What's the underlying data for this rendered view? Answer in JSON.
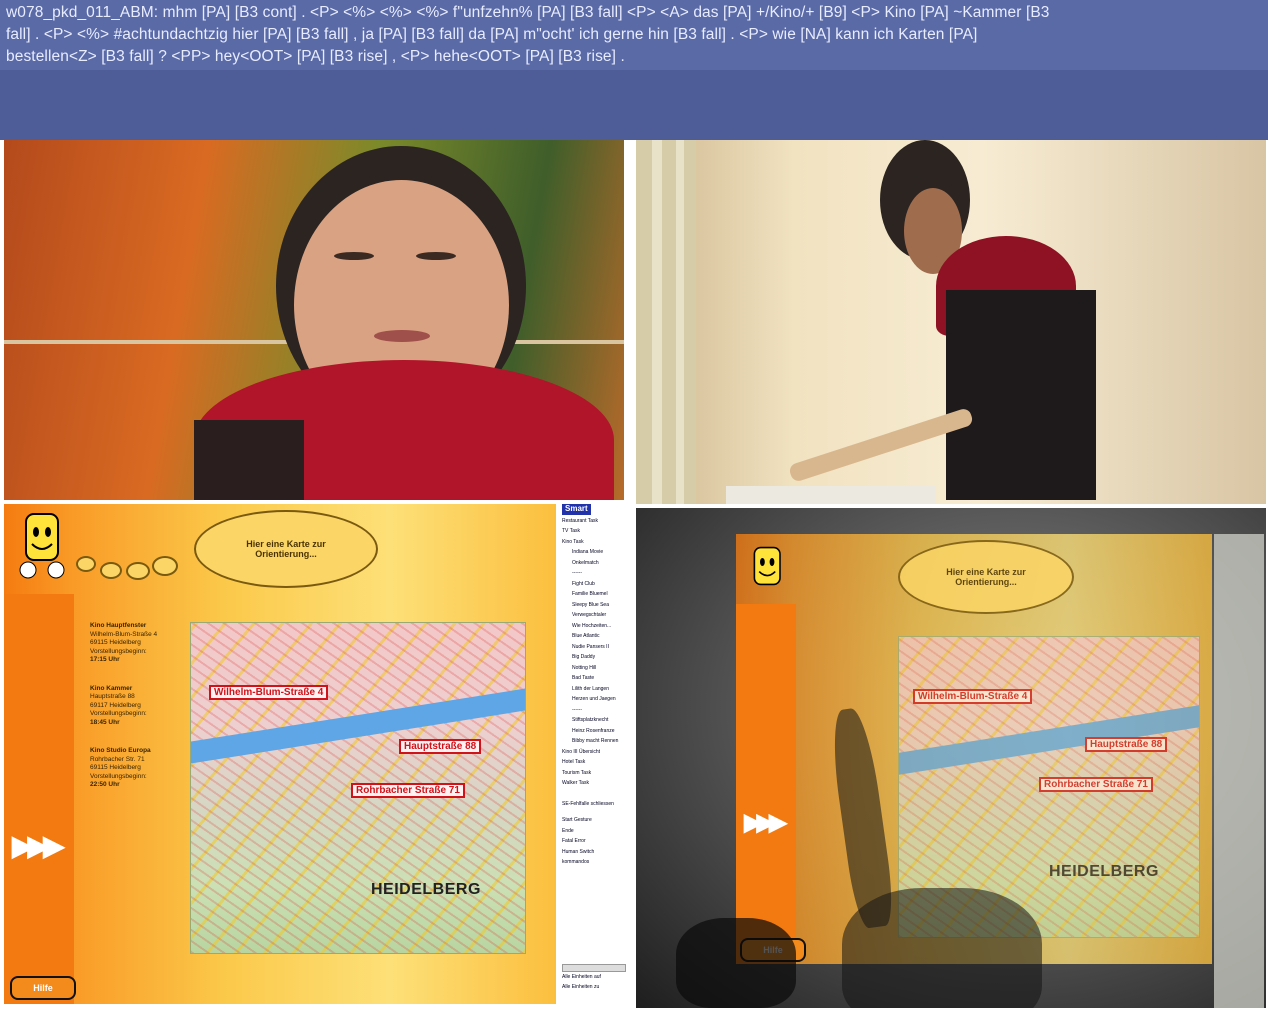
{
  "transcript": {
    "line1": "w078_pkd_011_ABM: mhm [PA] [B3 cont] . <P> <%> <%> <%> f\"unfzehn% [PA] [B3 fall] <P> <A> das [PA] +/Kino/+ [B9] <P> Kino [PA] ~Kammer [B3",
    "line2": "fall] . <P> <%> #achtundachtzig hier [PA] [B3 fall] , ja [PA] [B3 fall] da [PA] m\"ocht' ich gerne hin [B3 fall] . <P> wie [NA] kann ich Karten [PA]",
    "line3": "bestellen<Z> [B3 fall] ? <PP> hey<OOT> [PA] [B3 rise] , <P> hehe<OOT> [PA] [B3 rise] ."
  },
  "gui": {
    "speech_line1": "Hier eine Karte zur",
    "speech_line2": "Orientierung...",
    "cinemas": [
      {
        "name": "Kino Hauptfenster",
        "street": "Wilhelm-Blum-Straße 4",
        "city": "69115 Heidelberg",
        "label": "Vorstellungsbeginn:",
        "time": "17:15 Uhr"
      },
      {
        "name": "Kino Kammer",
        "street": "Hauptstraße 88",
        "city": "69117 Heidelberg",
        "label": "Vorstellungsbeginn:",
        "time": "18:45 Uhr"
      },
      {
        "name": "Kino Studio Europa",
        "street": "Rohrbacher Str. 71",
        "city": "69115 Heidelberg",
        "label": "Vorstellungsbeginn:",
        "time": "22:50 Uhr"
      }
    ],
    "map_labels": {
      "label1": "Wilhelm-Blum-Straße 4",
      "label2": "Hauptstraße 88",
      "label3": "Rohrbacher Straße 71",
      "city": "HEIDELBERG"
    },
    "hilfe": "Hilfe",
    "arrows": "▶▶▶",
    "tree_logo": "Smart",
    "tree": {
      "top": [
        "Restaurant Task",
        "TV Task",
        "Kino Task"
      ],
      "movies": [
        "Indiana Movie",
        "Onkelmatch",
        "------",
        "Fight Club",
        "Familie Bluemel",
        "Sleepy Blue Sea",
        "Verwegschtaler",
        "Wie Hochzeiten...",
        "Blue Atlantic",
        "Nudie Pansers II",
        "Big Daddy",
        "Notting Hill",
        "Bad Taste",
        "Lilith der Langen",
        "Herzen und Jaegen",
        "------",
        "Stiftsplatzknecht",
        "Heinz Rosenfranze",
        "Bibby macht Rennen"
      ],
      "bottom": [
        "Kino III Übersicht",
        "Hotel Task",
        "Tourism Task",
        "Walker Task"
      ],
      "footer": [
        "SE-Fehlfalle schliessen",
        "Start Gesture",
        "Ende",
        "Fatal Error",
        "Human Switch",
        "kommandos"
      ],
      "scroll": [
        "Alle Einheiten auf",
        "Alle Einheiten zu"
      ]
    }
  },
  "colors": {
    "transcript_bg": "#5a6aa6",
    "orange": "#f57b10",
    "map_label_red": "#d0121b"
  }
}
